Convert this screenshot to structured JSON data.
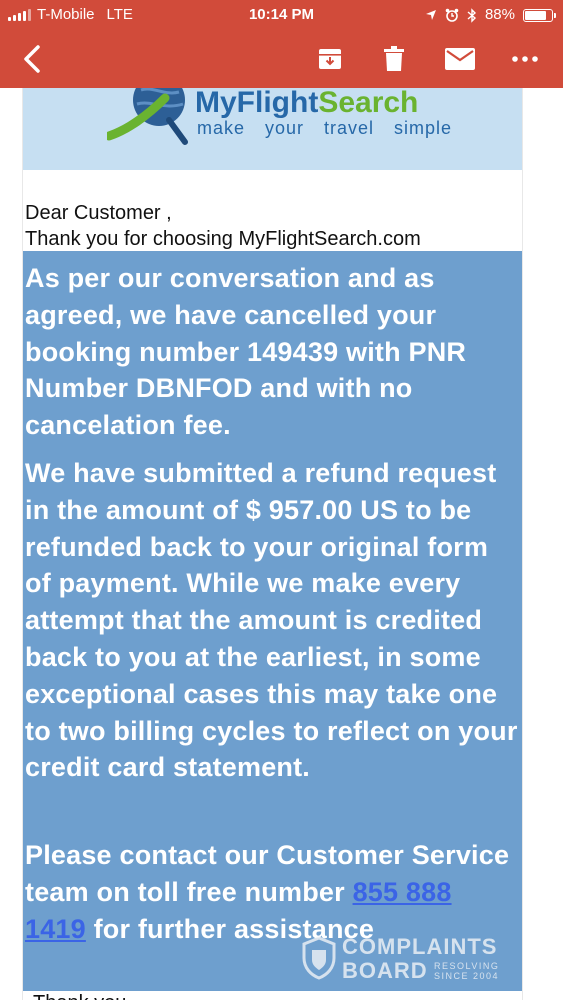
{
  "status_bar": {
    "carrier": "T-Mobile",
    "network": "LTE",
    "time": "10:14 PM",
    "battery": "88%",
    "battery_level": 0.88
  },
  "toolbar": {
    "back_icon": "back-arrow-icon",
    "archive_icon": "archive-icon",
    "delete_icon": "trash-icon",
    "unread_icon": "mail-icon",
    "more_icon": "more-icon"
  },
  "email": {
    "logo": {
      "brand_part1": "MyFlight",
      "brand_part2": "Search",
      "tagline": "make your travel simple"
    },
    "greeting_line1": "Dear Customer ,",
    "greeting_line2": "Thank you for choosing MyFlightSearch.com",
    "paragraph1": "As per our conversation and as agreed, we have cancelled your booking number 149439 with PNR Number DBNFOD and with no cancelation fee.",
    "paragraph2": "We have submitted a refund request in the amount of $ 957.00 US to be refunded back to your original form of payment. While we make every attempt that the amount is credited back to you at the earliest, in some exceptional cases this may take one to two billing cycles to reflect on your credit card statement.",
    "paragraph3_before": "Please contact our Customer Service team on toll free number",
    "phone": "855 888 1419",
    "paragraph3_after": "for further assistance",
    "thankyou": "Thank you"
  },
  "watermark": {
    "line1": "COMPLAINTS",
    "line2": "BOARD",
    "small1": "RESOLVING",
    "small2": "SINCE 2004"
  },
  "colors": {
    "header_red": "#d14b3a",
    "box_blue": "#6e9fce",
    "link_blue": "#3b64e6"
  }
}
